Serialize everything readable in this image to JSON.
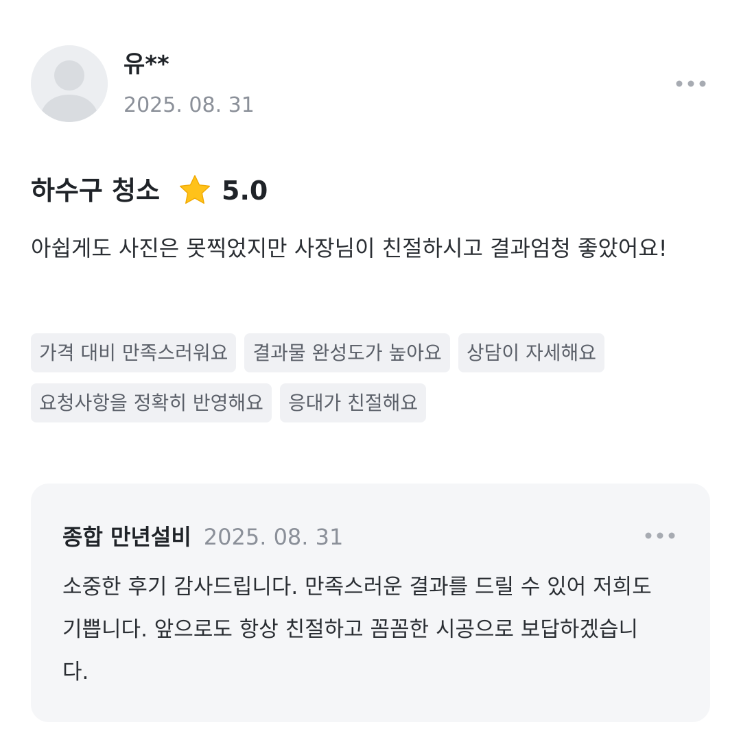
{
  "review": {
    "author": "유**",
    "date": "2025. 08. 31",
    "service": "하수구 청소",
    "rating": "5.0",
    "text": "아쉽게도 사진은 못찍었지만 사장님이 친절하시고 결과엄청 좋았어요!",
    "tags": [
      "가격 대비 만족스러워요",
      "결과물 완성도가 높아요",
      "상담이 자세해요",
      "요청사항을 정확히 반영해요",
      "응대가 친절해요"
    ]
  },
  "reply": {
    "author": "종합 만년설비",
    "date": "2025. 08. 31",
    "text": "소중한 후기 감사드립니다. 만족스러운 결과를 드릴 수 있어 저희도 기쁩니다. 앞으로도 항상 친절하고 꼼꼼한 시공으로 보답하겠습니다."
  },
  "icons": {
    "avatar": "default-user-avatar",
    "more": "more-horizontal-icon",
    "star": "star-icon"
  },
  "colors": {
    "star": "#ffc21a",
    "tag_bg": "#f0f1f4",
    "reply_bg": "#f5f6f8",
    "muted_text": "#8b9099"
  }
}
